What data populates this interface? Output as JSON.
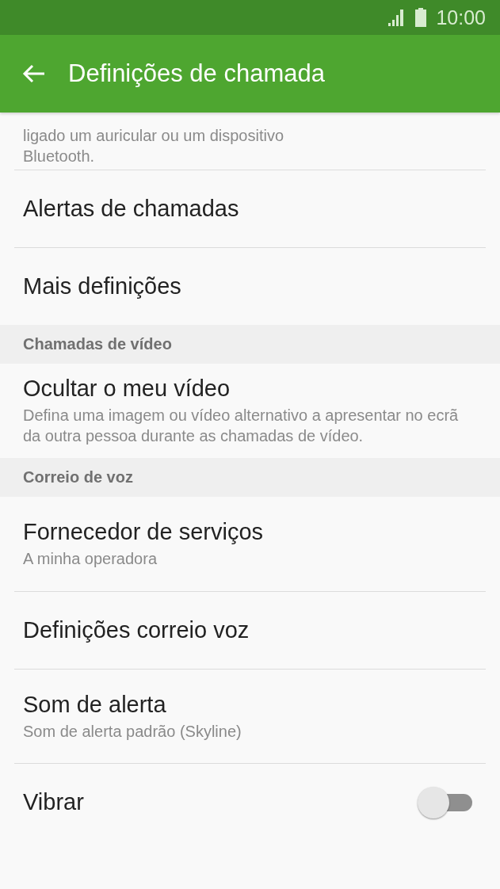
{
  "status_bar": {
    "time": "10:00"
  },
  "app_bar": {
    "title": "Definições de chamada"
  },
  "scrolled_text": {
    "lines": [
      "ligado um auricular ou um dispositivo",
      "Bluetooth."
    ]
  },
  "rows": [
    {
      "kind": "item",
      "title": "Alertas de chamadas"
    },
    {
      "kind": "item",
      "title": "Mais definições"
    },
    {
      "kind": "header",
      "title": "Chamadas de vídeo"
    },
    {
      "kind": "item",
      "title": "Ocultar o meu vídeo",
      "subtitle": "Defina uma imagem ou vídeo alternativo a apresentar no ecrã da outra pessoa durante as chamadas de vídeo."
    },
    {
      "kind": "header",
      "title": "Correio de voz"
    },
    {
      "kind": "item",
      "title": "Fornecedor de serviços",
      "subtitle": "A minha operadora"
    },
    {
      "kind": "item",
      "title": "Definições correio voz"
    },
    {
      "kind": "item",
      "title": "Som de alerta",
      "subtitle": "Som de alerta padrão (Skyline)"
    },
    {
      "kind": "switch",
      "title": "Vibrar",
      "on": false
    }
  ]
}
